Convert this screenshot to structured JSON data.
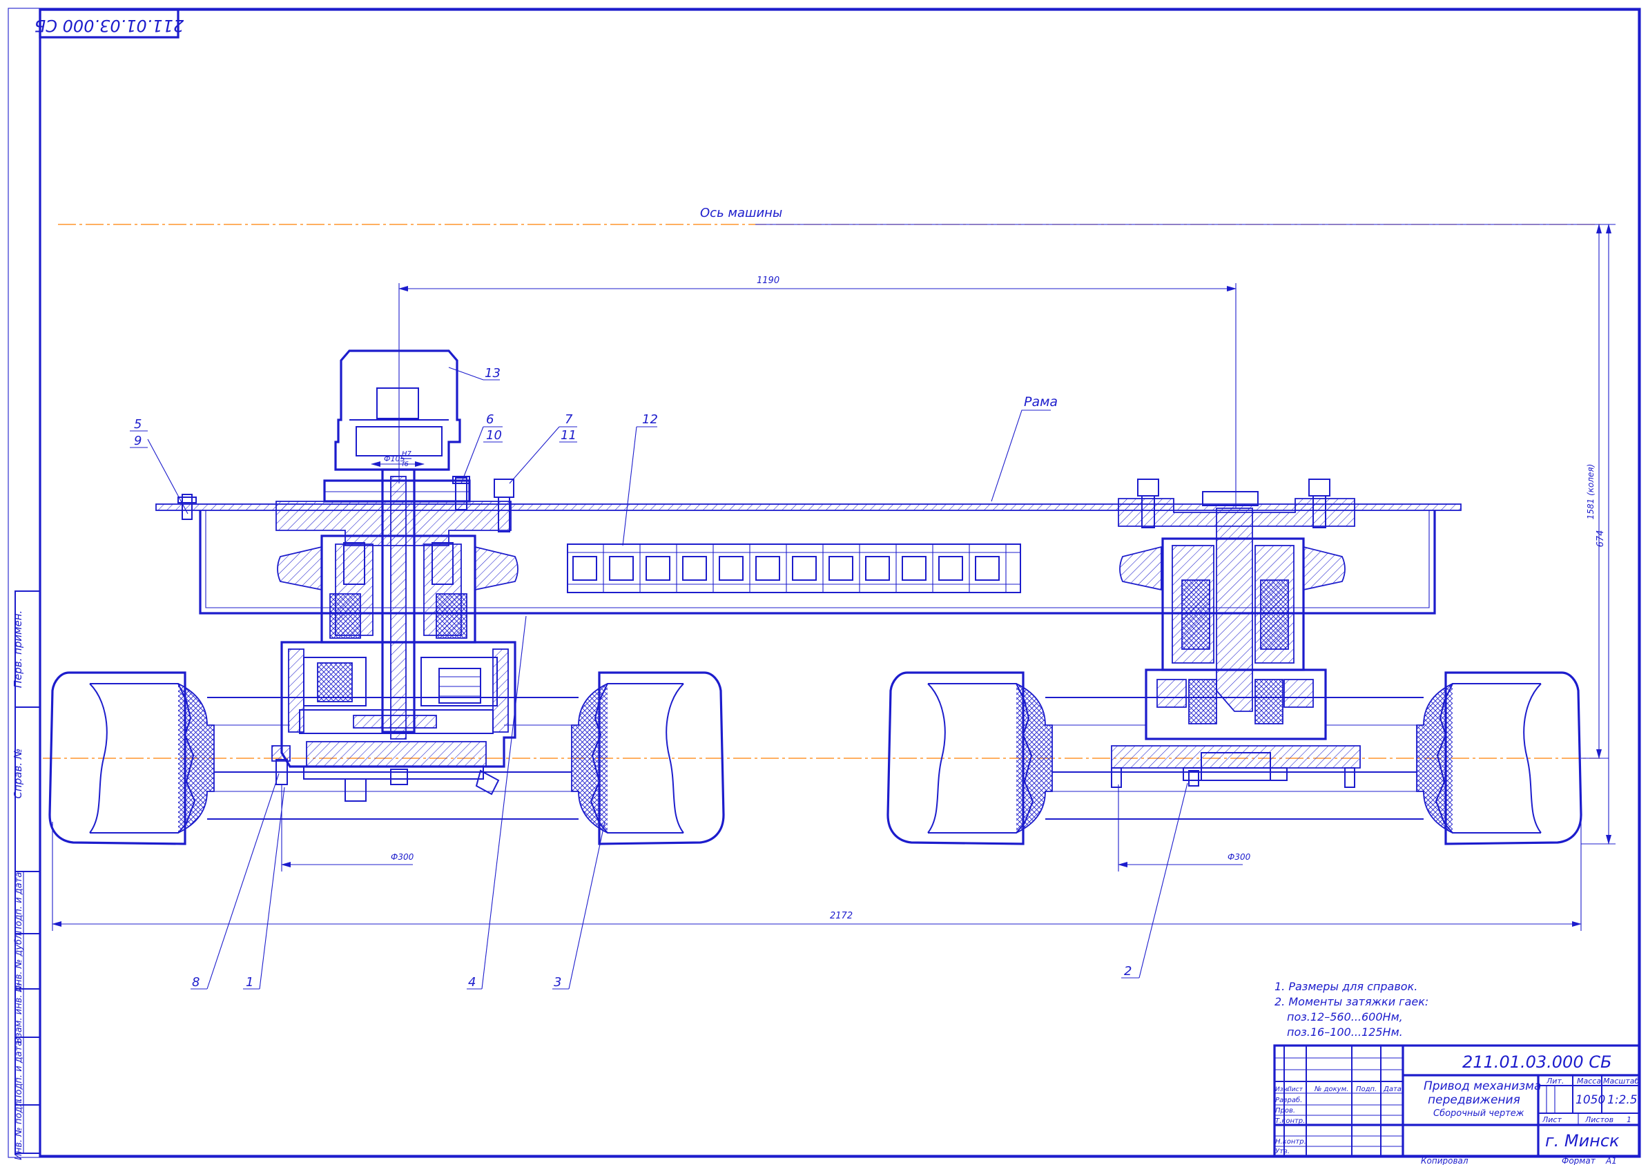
{
  "stamp": {
    "designation": "211.01.03.000 СБ"
  },
  "corner_code": "211.01.03.000 СБ",
  "axis_label": "Ось машины",
  "frame_label": "Рама",
  "dimensions": {
    "d1190": "1190",
    "d2172": "2172",
    "phi300_left": "Ф300",
    "phi300_right": "Ф300",
    "d674": "674",
    "d1581": "1581 (колея)",
    "fit_dia": "Ф105",
    "fit_num": "H7",
    "fit_den": "f6"
  },
  "positions": {
    "p1": "1",
    "p2": "2",
    "p3": "3",
    "p4": "4",
    "p5": "5",
    "p6": "6",
    "p7": "7",
    "p8": "8",
    "p9": "9",
    "p10": "10",
    "p11": "11",
    "p12": "12",
    "p13": "13"
  },
  "notes": [
    "1. Размеры для справок.",
    "2. Моменты затяжки гаек:",
    "поз.12–560...600Нм,",
    "поз.16–100...125Нм."
  ],
  "title_block": {
    "name1": "Привод механизма",
    "name2": "передвижения",
    "doc_type": "Сборочный чертеж",
    "lit_label": "Лит.",
    "mass_label": "Масса",
    "scale_label": "Масштаб",
    "mass": "1050",
    "scale": "1:2.5",
    "sheet_label": "Лист",
    "sheets_label": "Листов",
    "sheets": "1",
    "org": "г. Минск",
    "izm": "Изм.",
    "list_col": "Лист",
    "doc_col": "№ докум.",
    "sign_col": "Подп.",
    "date_col": "Дата",
    "razrab": "Разраб.",
    "prov": "Пров.",
    "tkontr": "Т.контр.",
    "nkontr": "Н.контр.",
    "utv": "Утв.",
    "copied": "Копировал",
    "format_label": "Формат",
    "format": "А1"
  },
  "side_stamp": [
    "Перв. примен.",
    "Справ. №",
    "Подп. и дата",
    "Инв. № дубл.",
    "Взам. инв. №",
    "Подп. и дата",
    "Инв. № подл."
  ]
}
